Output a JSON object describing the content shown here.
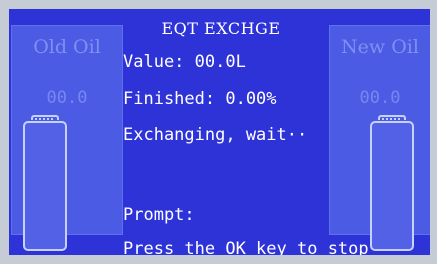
{
  "header": {
    "title": "EQT EXCHGE"
  },
  "left_panel": {
    "title": "Old Oil",
    "value": "00.0",
    "fill_fraction": 0.0
  },
  "right_panel": {
    "title": "New Oil",
    "value": "00.0",
    "fill_fraction": 0.0
  },
  "status": {
    "value_line": "Value:  00.0L",
    "finished_line": "Finished: 0.00%",
    "exchanging_line": "Exchanging, wait··"
  },
  "prompt": {
    "label": "Prompt:",
    "message": "Press the OK key  to stop"
  },
  "colors": {
    "screen_bg": "#2e33d8",
    "panel_bg": "#4b5be4",
    "text": "#ffffff",
    "faint_text": "#7f8ff2"
  }
}
